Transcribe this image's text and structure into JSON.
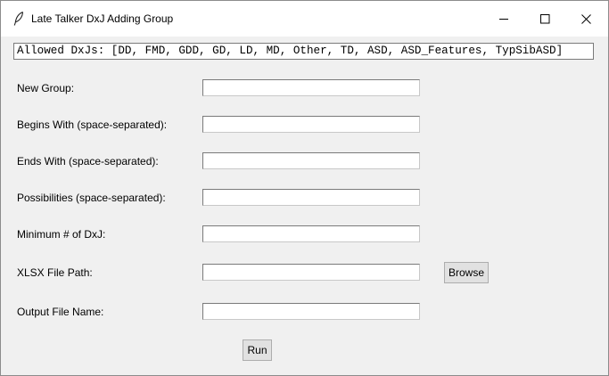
{
  "window": {
    "title": "Late Talker DxJ Adding Group",
    "controls": {
      "minimize": "minimize-icon",
      "maximize": "maximize-icon",
      "close": "close-icon"
    }
  },
  "allowed_dxjs": "Allowed DxJs: [DD, FMD, GDD, GD, LD, MD, Other, TD, ASD, ASD_Features, TypSibASD]",
  "form": {
    "fields": [
      {
        "label": "New Group:",
        "value": ""
      },
      {
        "label": "Begins With (space-separated):",
        "value": ""
      },
      {
        "label": "Ends With (space-separated):",
        "value": ""
      },
      {
        "label": "Possibilities (space-separated):",
        "value": ""
      },
      {
        "label": "Minimum # of DxJ:",
        "value": ""
      },
      {
        "label": "XLSX File Path:",
        "value": ""
      },
      {
        "label": "Output File Name:",
        "value": ""
      }
    ],
    "browse_label": "Browse",
    "run_label": "Run"
  },
  "colors": {
    "background": "#f0f0f0",
    "titlebar": "#ffffff",
    "button": "#e1e1e1"
  }
}
